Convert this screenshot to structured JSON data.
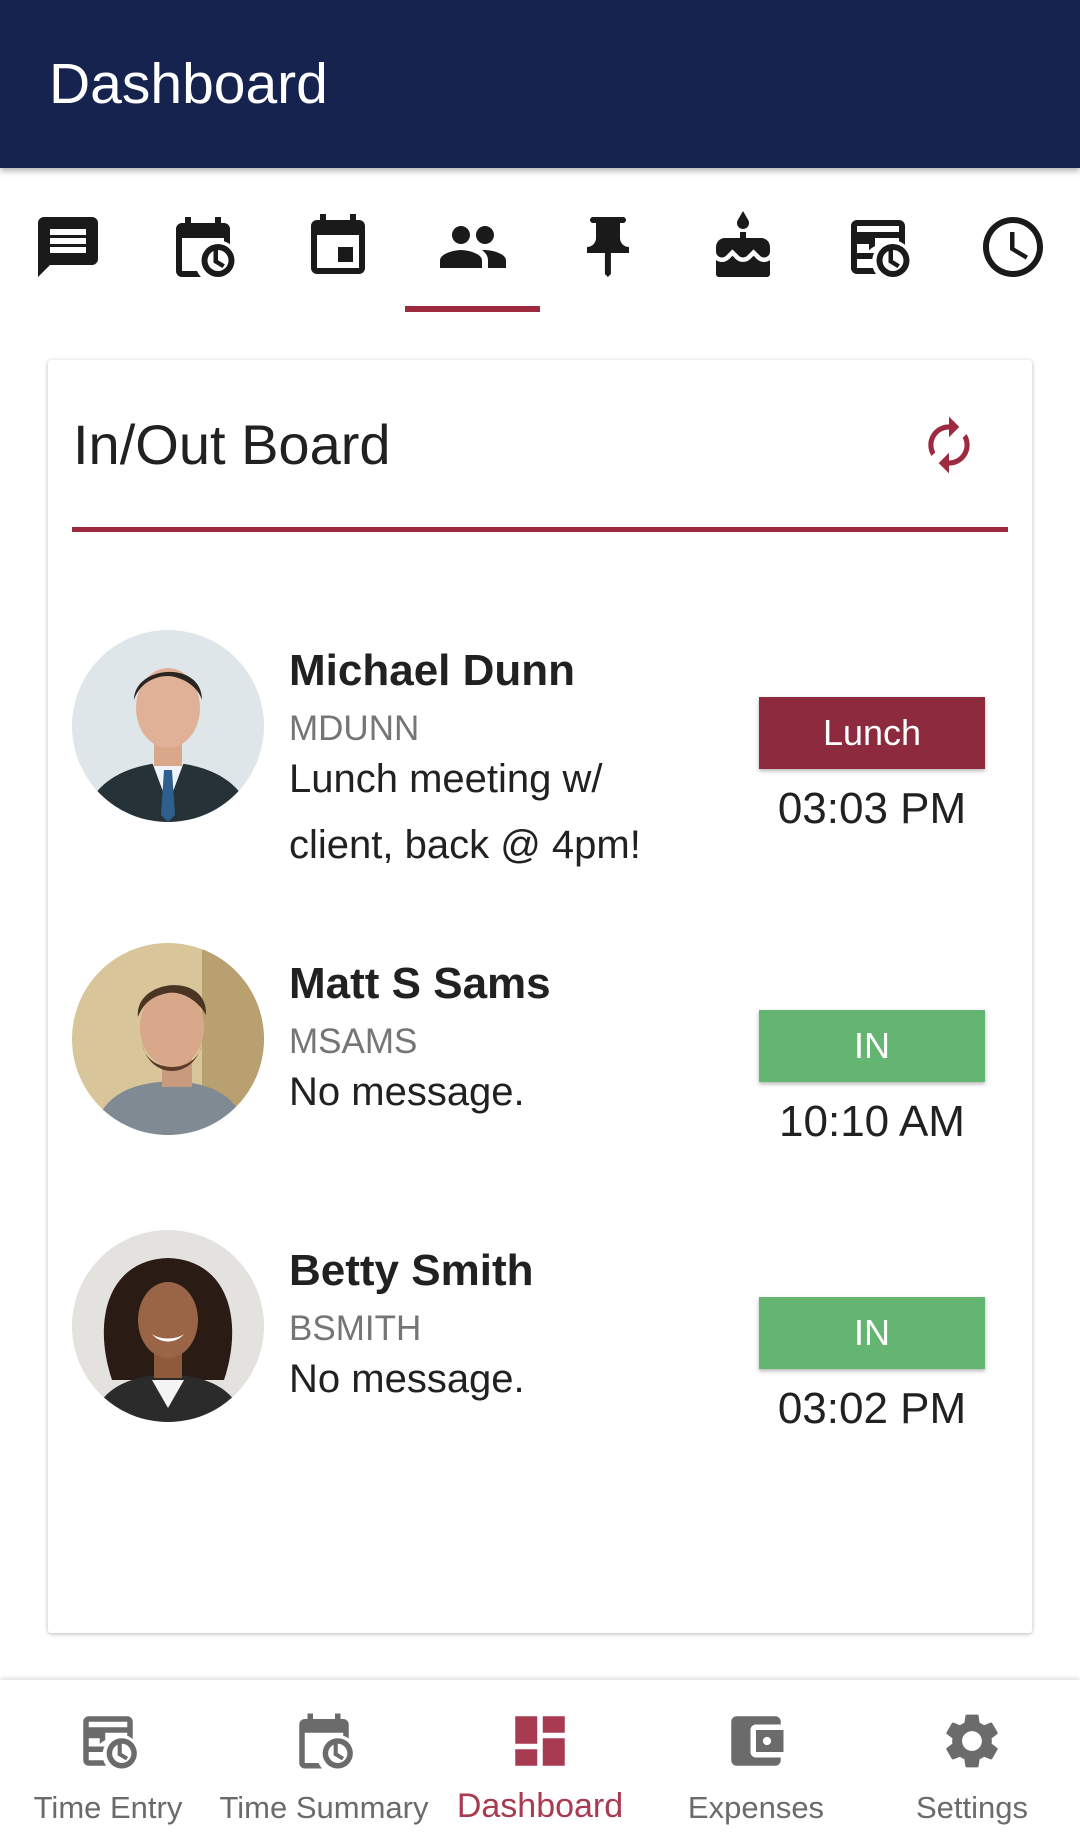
{
  "appbar": {
    "title": "Dashboard"
  },
  "icon_tabs": [
    {
      "icon": "message-icon",
      "selected": false
    },
    {
      "icon": "calendar-clock-icon",
      "selected": false
    },
    {
      "icon": "calendar-event-icon",
      "selected": false
    },
    {
      "icon": "people-icon",
      "selected": true
    },
    {
      "icon": "pin-icon",
      "selected": false
    },
    {
      "icon": "cake-icon",
      "selected": false
    },
    {
      "icon": "timesheet-icon",
      "selected": false
    },
    {
      "icon": "clock-icon",
      "selected": false
    }
  ],
  "board": {
    "title": "In/Out Board",
    "refresh_icon": "refresh-icon",
    "people": [
      {
        "name": "Michael Dunn",
        "code": "MDUNN",
        "message": "Lunch meeting w/ client, back @ 4pm!",
        "status": "Lunch",
        "status_color": "#8e2a3e",
        "time": "03:03 PM"
      },
      {
        "name": "Matt S Sams",
        "code": "MSAMS",
        "message": "No message.",
        "status": "IN",
        "status_color": "#63b571",
        "time": "10:10 AM"
      },
      {
        "name": "Betty Smith",
        "code": "BSMITH",
        "message": "No message.",
        "status": "IN",
        "status_color": "#63b571",
        "time": "03:02 PM"
      }
    ]
  },
  "bottom_nav": {
    "items": [
      {
        "label": "Time Entry",
        "icon": "timesheet-icon",
        "active": false
      },
      {
        "label": "Time Summary",
        "icon": "calendar-clock-icon",
        "active": false
      },
      {
        "label": "Dashboard",
        "icon": "dashboard-icon",
        "active": true
      },
      {
        "label": "Expenses",
        "icon": "wallet-icon",
        "active": false
      },
      {
        "label": "Settings",
        "icon": "gear-icon",
        "active": false
      }
    ]
  },
  "colors": {
    "appbar": "#16234f",
    "accent": "#9e2a3f",
    "in": "#63b571",
    "lunch": "#8e2a3e"
  }
}
